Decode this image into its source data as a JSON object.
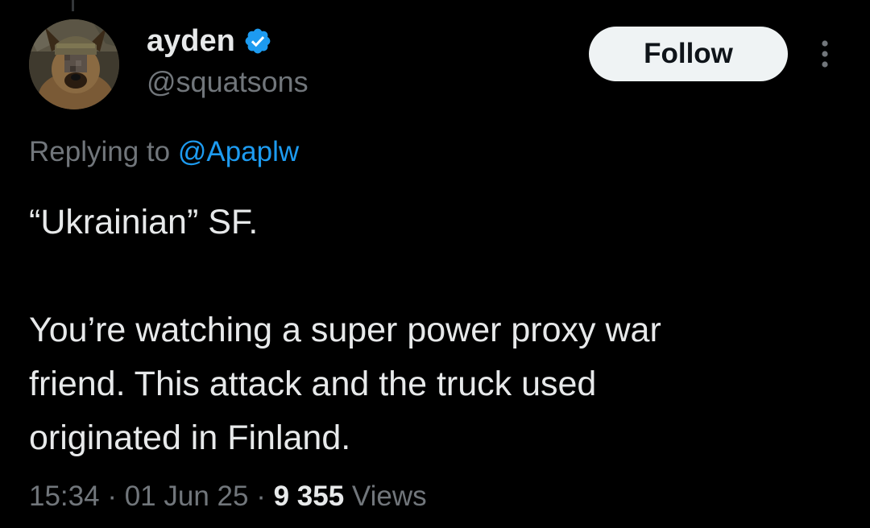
{
  "colors": {
    "background": "#000000",
    "primary_text": "#e7e9ea",
    "secondary_text": "#71767b",
    "link": "#1d9bf0",
    "verified_badge": "#1d9bf0",
    "follow_button_bg": "#eff3f4",
    "follow_button_text": "#0f1419"
  },
  "author": {
    "display_name": "ayden",
    "handle": "@squatsons",
    "verified": true,
    "verified_icon": "verified-badge-icon",
    "avatar_icon": "dog-avatar"
  },
  "actions": {
    "follow_label": "Follow",
    "more_icon": "vertical-ellipsis-icon"
  },
  "reply": {
    "prefix": "Replying to",
    "mention": "@Apaplw"
  },
  "tweet": {
    "line1": "“Ukrainian” SF.",
    "line2": "You’re watching a super power proxy war",
    "line3": "friend. This attack and the truck used",
    "line4": "originated in Finland."
  },
  "meta": {
    "time": "15:34",
    "separator": "·",
    "date": "01 Jun 25",
    "views_count": "9 355",
    "views_label": "Views"
  }
}
